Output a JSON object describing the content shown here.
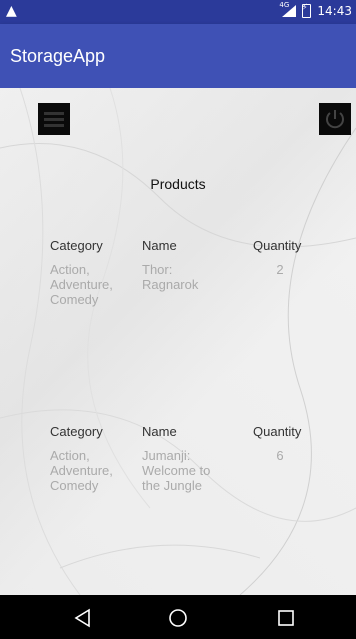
{
  "status_bar": {
    "network": "4G",
    "time": "14:43"
  },
  "app_bar": {
    "title": "StorageApp"
  },
  "page": {
    "title": "Products"
  },
  "table_headers": {
    "category": "Category",
    "name": "Name",
    "quantity": "Quantity"
  },
  "products": [
    {
      "category_lines": [
        "Action,",
        "Adventure,",
        "Comedy"
      ],
      "name_lines": [
        "Thor:",
        "Ragnarok"
      ],
      "quantity": "2"
    },
    {
      "category_lines": [
        "Action,",
        "Adventure,",
        "Comedy"
      ],
      "name_lines": [
        "Jumanji:",
        "Welcome to",
        "the Jungle"
      ],
      "quantity": "6"
    }
  ],
  "icons": {
    "menu": "hamburger-menu-icon",
    "power": "power-icon",
    "back": "triangle-back-icon",
    "home": "circle-home-icon",
    "recents": "square-recents-icon"
  },
  "colors": {
    "status_bar": "#2b3a9a",
    "app_bar": "#3f51b5",
    "nav_bar": "#000000"
  }
}
